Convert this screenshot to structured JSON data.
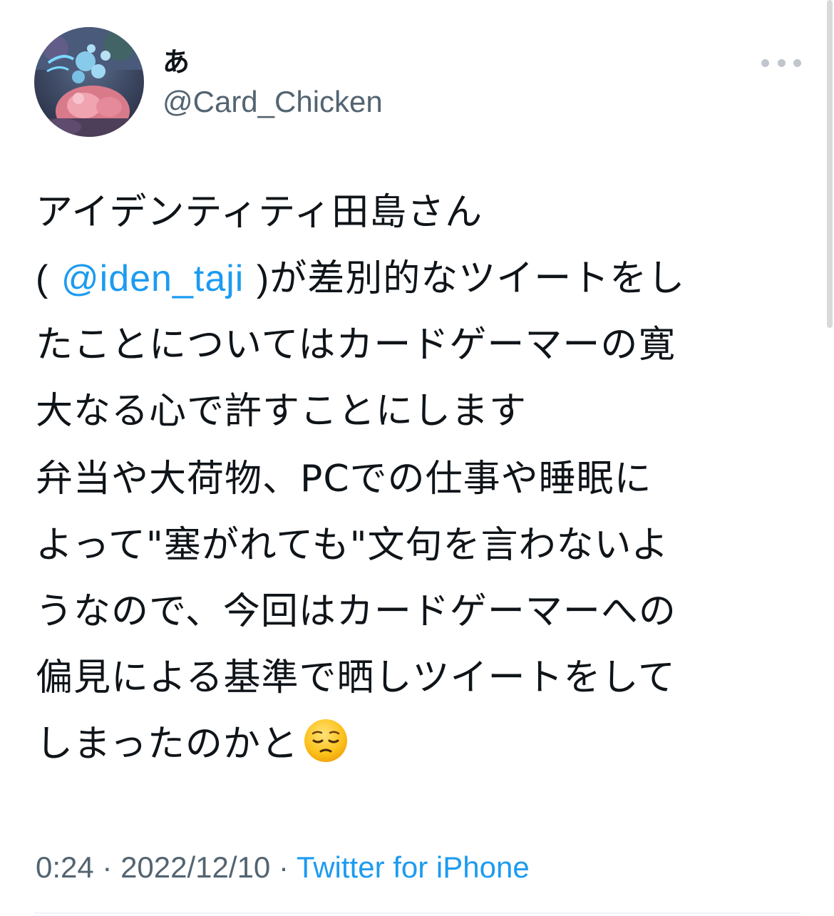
{
  "author": {
    "display_name": "あ",
    "handle": "@Card_Chicken",
    "avatar_icon": "avatar-image"
  },
  "more_button": {
    "icon": "more-horizontal-icon"
  },
  "tweet": {
    "paragraph1": {
      "line1": "アイデンティティ田島さん",
      "open_paren": "(",
      "mention": "@iden_taji",
      "close_paren": ")",
      "line2_rest": "が差別的なツイートをし",
      "line3": "たことについてはカードゲーマーの寛",
      "line4": "大なる心で許すことにします"
    },
    "paragraph2": {
      "line1": "弁当や大荷物、PCでの仕事や睡眠に",
      "line2": "よって\"塞がれても\"文句を言わないよ",
      "line3": "うなので、今回はカードゲーマーへの",
      "line4": "偏見による基準で晒しツイートをして",
      "line5": "しまったのかと",
      "emoji": "pensive-face-emoji"
    }
  },
  "meta": {
    "time": "0:24",
    "separator1": " · ",
    "date": "2022/12/10",
    "separator2": " · ",
    "source": "Twitter for iPhone"
  },
  "colors": {
    "text": "#0f1419",
    "secondary": "#536471",
    "link": "#1d9bf0",
    "divider": "#eff3f4"
  }
}
